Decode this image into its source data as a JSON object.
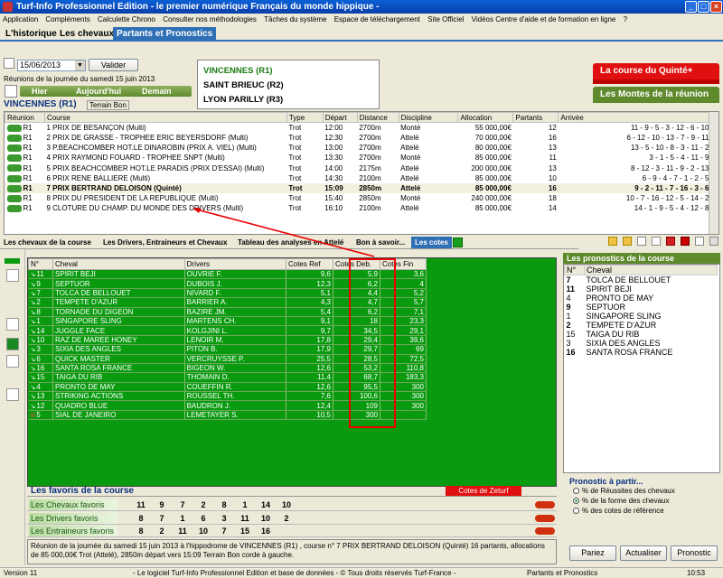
{
  "window": {
    "title": "Turf-Info Professionnel Edition - le premier numérique Français du monde hippique -"
  },
  "menu": [
    "Application",
    "Compléments",
    "Calculette Chrono",
    "Consulter nos méthodologies",
    "Tâches du système",
    "Espace de téléchargement",
    "Site Officiel",
    "Vidéos Centre d'aide et de formation en ligne",
    "?"
  ],
  "tabs": [
    "L'historique",
    "Les chevaux",
    "Partants et Pronostics"
  ],
  "date": {
    "value": "15/06/2013",
    "validate": "Valider",
    "caption": "Réunions de la journée du samedi 15 juin 2013",
    "hier": "Hier",
    "today": "Aujourd'hui",
    "demain": "Demain"
  },
  "reunions": [
    "VINCENNES (R1)",
    "SAINT BRIEUC (R2)",
    "LYON PARILLY (R3)"
  ],
  "right_buttons": {
    "quinte": "La course du Quinté+",
    "montes": "Les Montes de la réunion"
  },
  "meeting": {
    "name": "VINCENNES (R1)",
    "terrain": "Terrain Bon"
  },
  "race_columns": [
    "Réunion",
    "Course",
    "Type",
    "Départ",
    "Distance",
    "Discipline",
    "Allocation",
    "Partants",
    "Arrivée"
  ],
  "races": [
    {
      "r": "R1",
      "c": "1 PRIX DE BESANÇON (Multi)",
      "t": "Trot",
      "d": "12:00",
      "dist": "2700m",
      "disc": "Monté",
      "alloc": "55 000,00€",
      "p": "12",
      "arr": "11 - 9 - 5 - 3 - 12 - 6 - 10"
    },
    {
      "r": "R1",
      "c": "2 PRIX DE GRASSE - TROPHEE ERIC BEYERSDORF (Multi)",
      "t": "Trot",
      "d": "12:30",
      "dist": "2700m",
      "disc": "Attelé",
      "alloc": "70 000,00€",
      "p": "16",
      "arr": "6 - 12 - 10 - 13 - 7 - 9 - 11"
    },
    {
      "r": "R1",
      "c": "3 P.BEACHCOMBER HOT.LE DINAROBIN (PRIX A. VIEL) (Multi)",
      "t": "Trot",
      "d": "13:00",
      "dist": "2700m",
      "disc": "Attelé",
      "alloc": "80 000,00€",
      "p": "13",
      "arr": "13 - 5 - 10 - 8 - 3 - 11 - 2"
    },
    {
      "r": "R1",
      "c": "4 PRIX RAYMOND FOUARD - TROPHEE SNPT (Multi)",
      "t": "Trot",
      "d": "13:30",
      "dist": "2700m",
      "disc": "Monté",
      "alloc": "85 000,00€",
      "p": "11",
      "arr": "3 - 1 - 5 - 4 - 11 - 9"
    },
    {
      "r": "R1",
      "c": "5 PRIX BEACHCOMBER HOT.LE PARADIS (PRIX D'ESSAI) (Multi)",
      "t": "Trot",
      "d": "14:00",
      "dist": "2175m",
      "disc": "Attelé",
      "alloc": "200 000,00€",
      "p": "13",
      "arr": "8 - 12 - 3 - 11 - 9 - 2 - 13"
    },
    {
      "r": "R1",
      "c": "6 PRIX RENE BALLIERE (Multi)",
      "t": "Trot",
      "d": "14:30",
      "dist": "2100m",
      "disc": "Attelé",
      "alloc": "85 000,00€",
      "p": "10",
      "arr": "6 - 9 - 4 - 7 - 1 - 2 - 5"
    },
    {
      "r": "R1",
      "c": "7 PRIX BERTRAND DELOISON (Quinté)",
      "t": "Trot",
      "d": "15:09",
      "dist": "2850m",
      "disc": "Attelé",
      "alloc": "85 000,00€",
      "p": "16",
      "arr": "9 - 2 - 11 - 7 - 16 - 3 - 6"
    },
    {
      "r": "R1",
      "c": "8 PRIX DU PRESIDENT DE LA REPUBLIQUE (Multi)",
      "t": "Trot",
      "d": "15:40",
      "dist": "2850m",
      "disc": "Monté",
      "alloc": "240 000,00€",
      "p": "18",
      "arr": "10 - 7 - 16 - 12 - 5 - 14 - 2"
    },
    {
      "r": "R1",
      "c": "9 CLOTURE DU CHAMP. DU MONDE DES DRIVERS (Multi)",
      "t": "Trot",
      "d": "16:10",
      "dist": "2100m",
      "disc": "Attelé",
      "alloc": "85 000,00€",
      "p": "14",
      "arr": "14 - 1 - 9 - 5 - 4 - 12 - 8"
    }
  ],
  "subtabs": [
    "Les chevaux de la course",
    "Les Drivers, Entraineurs et Chevaux",
    "Tableau des analyses en Attelé",
    "Bon à savoir...",
    "Les cotes"
  ],
  "cotes_columns": [
    "N°",
    "Cheval",
    "Drivers",
    "Cotes Ref",
    "Cotes Deb.",
    "Cotes Fin"
  ],
  "cotes": [
    {
      "n": "11",
      "c": "SPIRIT BEJI",
      "d": "OUVRIE F.",
      "ref": "9,6",
      "deb": "5,9",
      "fin": "3,6"
    },
    {
      "n": "9",
      "c": "SEPTUOR",
      "d": "DUBOIS J.",
      "ref": "12,3",
      "deb": "6,2",
      "fin": "4"
    },
    {
      "n": "7",
      "c": "TOLCA DE BELLOUET",
      "d": "NIVARD F.",
      "ref": "5,1",
      "deb": "4,4",
      "fin": "5,2"
    },
    {
      "n": "2",
      "c": "TEMPETE D'AZUR",
      "d": "BARRIER A.",
      "ref": "4,3",
      "deb": "4,7",
      "fin": "5,7"
    },
    {
      "n": "8",
      "c": "TORNADE DU DIGEON",
      "d": "BAZIRE JM.",
      "ref": "5,4",
      "deb": "6,2",
      "fin": "7,1"
    },
    {
      "n": "1",
      "c": "SINGAPORE SLING",
      "d": "MARTENS CH.",
      "ref": "9,1",
      "deb": "18",
      "fin": "23,3"
    },
    {
      "n": "14",
      "c": "JUGGLE FACE",
      "d": "KOLGJINI L.",
      "ref": "9,7",
      "deb": "34,5",
      "fin": "29,1"
    },
    {
      "n": "10",
      "c": "RAZ DE MAREE HONEY",
      "d": "LENOIR M.",
      "ref": "17,8",
      "deb": "29,4",
      "fin": "39,6"
    },
    {
      "n": "3",
      "c": "SIXIA DES ANGLES",
      "d": "PITON B.",
      "ref": "17,9",
      "deb": "29,7",
      "fin": "69"
    },
    {
      "n": "6",
      "c": "QUICK MASTER",
      "d": "VERCRUYSSE P.",
      "ref": "25,5",
      "deb": "28,5",
      "fin": "72,5"
    },
    {
      "n": "16",
      "c": "SANTA ROSA FRANCE",
      "d": "BIGEON W.",
      "ref": "12,6",
      "deb": "53,2",
      "fin": "110,8"
    },
    {
      "n": "15",
      "c": "TAIGA DU RIB",
      "d": "THOMAIN D.",
      "ref": "11,4",
      "deb": "68,7",
      "fin": "183,3"
    },
    {
      "n": "4",
      "c": "PRONTO DE MAY",
      "d": "COUEFFIN R.",
      "ref": "12,6",
      "deb": "95,5",
      "fin": "300"
    },
    {
      "n": "13",
      "c": "STRIKING ACTIONS",
      "d": "ROUSSEL TH.",
      "ref": "7,6",
      "deb": "100,6",
      "fin": "300"
    },
    {
      "n": "12",
      "c": "QUADRO BLUE",
      "d": "BAUDRON J.",
      "ref": "12,4",
      "deb": "109",
      "fin": "300"
    },
    {
      "n": "5",
      "c": "SIAL DE JANEIRO",
      "d": "LEMETAYER S.",
      "ref": "10,5",
      "deb": "300",
      "fin": ""
    }
  ],
  "pronostics": {
    "title": "Les pronostics de la course",
    "columns": [
      "N°",
      "Cheval"
    ],
    "rows": [
      {
        "n": "7",
        "c": "TOLCA DE BELLOUET",
        "b": true
      },
      {
        "n": "11",
        "c": "SPIRIT BEJI",
        "b": true
      },
      {
        "n": "4",
        "c": "PRONTO DE MAY",
        "b": false
      },
      {
        "n": "9",
        "c": "SEPTUOR",
        "b": true
      },
      {
        "n": "1",
        "c": "SINGAPORE SLING",
        "b": false
      },
      {
        "n": "2",
        "c": "TEMPETE D'AZUR",
        "b": true
      },
      {
        "n": "15",
        "c": "TAIGA DU RIB",
        "b": false
      },
      {
        "n": "3",
        "c": "SIXIA DES ANGLES",
        "b": false
      },
      {
        "n": "16",
        "c": "SANTA ROSA FRANCE",
        "b": true
      }
    ]
  },
  "favoris": {
    "title": "Les favoris de la course",
    "zeturf": "Cotes de Zeturf",
    "rows": [
      {
        "label": "Les Chevaux favoris",
        "values": [
          "11",
          "9",
          "7",
          "2",
          "8",
          "1",
          "14",
          "10"
        ]
      },
      {
        "label": "Les Drivers favoris",
        "values": [
          "8",
          "7",
          "1",
          "6",
          "3",
          "11",
          "10",
          "2"
        ]
      },
      {
        "label": "Les Entraineurs favoris",
        "values": [
          "8",
          "2",
          "11",
          "10",
          "7",
          "15",
          "16",
          ""
        ]
      }
    ]
  },
  "description": "Réunion de la journée du samedi 15 juin 2013 à l'hippodrome de VINCENNES (R1) , course n° 7 PRIX BERTRAND DELOISON (Quinté) 16 partants, allocations de 85 000,00€ Trot (Attelé), 2850m départ vers 15:09 Terrain Bon corde à gauche.",
  "prono_options": {
    "title": "Pronostic à partir...",
    "options": [
      "% de Réussites des chevaux",
      "% de la forme des chevaux",
      "% des cotes de référence"
    ],
    "selected": 1
  },
  "bottom_buttons": [
    "Pariez",
    "Actualiser",
    "Pronostic"
  ],
  "statusbar": {
    "version": "Version 11",
    "copyright": "- Le logiciel Turf-Info Professionnel Edition et base de données - © Tous droits réservés Turf-France -",
    "mode": "Partants et Pronostics",
    "time": "10:53"
  },
  "colors": {
    "green_grid": "#0a9a10",
    "accent_blue": "#2f6fb5",
    "red_button": "#e01010",
    "header_green": "#5e8a2c"
  }
}
